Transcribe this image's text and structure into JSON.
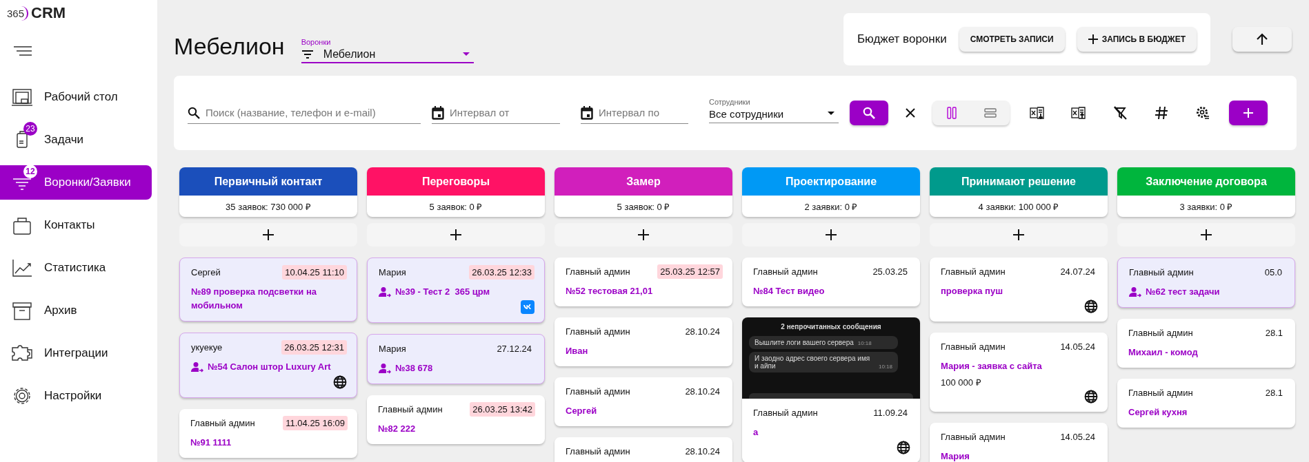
{
  "sidebar": {
    "logo": {
      "mark": "365",
      "name": "CRM"
    },
    "items": [
      {
        "label": "Рабочий стол",
        "kind": "desktop",
        "selected": false
      },
      {
        "label": "Задачи",
        "kind": "tasks",
        "badge": "23",
        "selected": false
      },
      {
        "label": "Воронки/Заявки",
        "kind": "funnel",
        "badge": "12",
        "selected": true
      },
      {
        "label": "Контакты",
        "kind": "contacts",
        "selected": false
      },
      {
        "label": "Статистика",
        "kind": "stats",
        "selected": false
      },
      {
        "label": "Архив",
        "kind": "archive",
        "selected": false
      },
      {
        "label": "Интеграции",
        "kind": "integrations",
        "selected": false
      },
      {
        "label": "Настройки",
        "kind": "settings",
        "selected": false
      }
    ]
  },
  "header": {
    "title": "Мебелион",
    "funnel_select": {
      "label": "Воронки",
      "value": "Мебелион"
    },
    "budget": {
      "label": "Бюджет воронки",
      "buttons": [
        {
          "label": "СМОТРЕТЬ ЗАПИСИ",
          "kind": "view"
        },
        {
          "label": "ЗАПИСЬ В БЮДЖЕТ",
          "kind": "add"
        }
      ]
    }
  },
  "filters": {
    "search": {
      "placeholder": "Поиск (название, телефон и e-mail)"
    },
    "date_from": {
      "placeholder": "Интервал от"
    },
    "date_to": {
      "placeholder": "Интервал по"
    },
    "employees": {
      "label": "Сотрудники",
      "value": "Все сотрудники"
    },
    "view_modes": [
      {
        "kind": "columns",
        "selected": true
      },
      {
        "kind": "rows",
        "selected": false
      }
    ],
    "tools": [
      {
        "kind": "excel-import"
      },
      {
        "kind": "excel-export"
      },
      {
        "kind": "filter-off"
      },
      {
        "kind": "hash"
      },
      {
        "kind": "settings"
      }
    ]
  },
  "columns": [
    {
      "title": "Первичный контакт",
      "count": "35 заявок: 730 000 ₽",
      "color": "#1b4fbb",
      "cards": [
        {
          "author": "Сергей",
          "date": "10.04.25 11:10",
          "overdue": true,
          "highlighted": true,
          "contact": false,
          "title": "№89 проверка подсветки на мобильном"
        },
        {
          "author": "укуекуе",
          "date": "26.03.25 12:31",
          "overdue": true,
          "highlighted": true,
          "contact": true,
          "title": "№54 Салон штор Luxury Art",
          "channel": {
            "kind": "web"
          }
        },
        {
          "author": "Главный админ",
          "date": "11.04.25 16:09",
          "overdue": true,
          "highlighted": false,
          "contact": false,
          "title": "№91 1111"
        }
      ]
    },
    {
      "title": "Переговоры",
      "count": "5 заявок: 0 ₽",
      "color": "#ff1265",
      "cards": [
        {
          "author": "Мария",
          "date": "26.03.25 12:33",
          "overdue": true,
          "highlighted": true,
          "contact": true,
          "title": "№39 - Тест 2  365 црм",
          "channel": {
            "kind": "vk"
          }
        },
        {
          "author": "Мария",
          "date": "27.12.24",
          "overdue": false,
          "highlighted": true,
          "contact": true,
          "title": "№38 678"
        },
        {
          "author": "Главный админ",
          "date": "26.03.25 13:42",
          "overdue": true,
          "highlighted": false,
          "contact": false,
          "title": "№82 222"
        }
      ]
    },
    {
      "title": "Замер",
      "count": "5 заявок: 0 ₽",
      "color": "#d11fbc",
      "cards": [
        {
          "author": "Главный админ",
          "date": "25.03.25 12:57",
          "overdue": true,
          "highlighted": false,
          "contact": false,
          "title": "№52 тестовая 21,01"
        },
        {
          "author": "Главный админ",
          "date": "28.10.24",
          "overdue": false,
          "highlighted": false,
          "contact": false,
          "title": "Иван"
        },
        {
          "author": "Главный админ",
          "date": "28.10.24",
          "overdue": false,
          "highlighted": false,
          "contact": false,
          "title": "Сергей"
        },
        {
          "author": "Главный админ",
          "date": "28.10.24",
          "overdue": false,
          "highlighted": false
        }
      ]
    },
    {
      "title": "Проектирование",
      "count": "2 заявки: 0 ₽",
      "color": "#0099f5",
      "cards": [
        {
          "author": "Главный админ",
          "date": "25.03.25",
          "overdue": false,
          "highlighted": false,
          "contact": false,
          "title": "№84 Тест видео"
        },
        {
          "author": "Главный админ",
          "date": "11.09.24",
          "overdue": false,
          "highlighted": false,
          "contact": false,
          "title": "а",
          "channel": {
            "kind": "web"
          },
          "attachment": {
            "header": "2 непрочитанных сообщения",
            "messages": [
              {
                "text": "Вышлите логи вашего сервера",
                "time": "10:18"
              },
              {
                "text": "И заодно адрес своего сервера имя и айпи",
                "time": "10:18"
              }
            ]
          }
        }
      ]
    },
    {
      "title": "Принимают решение",
      "count": "4 заявки: 100 000 ₽",
      "color": "#009a8c",
      "cards": [
        {
          "author": "Главный админ",
          "date": "24.07.24",
          "overdue": false,
          "highlighted": false,
          "contact": false,
          "title": "проверка пуш",
          "channel": {
            "kind": "web"
          }
        },
        {
          "author": "Главный админ",
          "date": "14.05.24",
          "overdue": false,
          "highlighted": false,
          "contact": false,
          "title": "Мария - заявка с сайта",
          "amount": "100 000 ₽",
          "channel": {
            "kind": "web"
          }
        },
        {
          "author": "Главный админ",
          "date": "14.05.24",
          "overdue": false,
          "highlighted": false,
          "contact": false,
          "title": "Мария"
        }
      ]
    },
    {
      "title": "Заключение договора",
      "count": "3 заявки: 0 ₽",
      "color": "#00b53d",
      "cards": [
        {
          "author": "Главный админ",
          "date": "05.0",
          "overdue": false,
          "highlighted": true,
          "contact": true,
          "title": "№62 тест задачи"
        },
        {
          "author": "Главный админ",
          "date": "28.1",
          "overdue": false,
          "highlighted": false,
          "contact": false,
          "title": "Михаил - комод"
        },
        {
          "author": "Главный админ",
          "date": "28.1",
          "overdue": false,
          "highlighted": false,
          "contact": false,
          "title": "Сергей кухня"
        }
      ]
    }
  ]
}
